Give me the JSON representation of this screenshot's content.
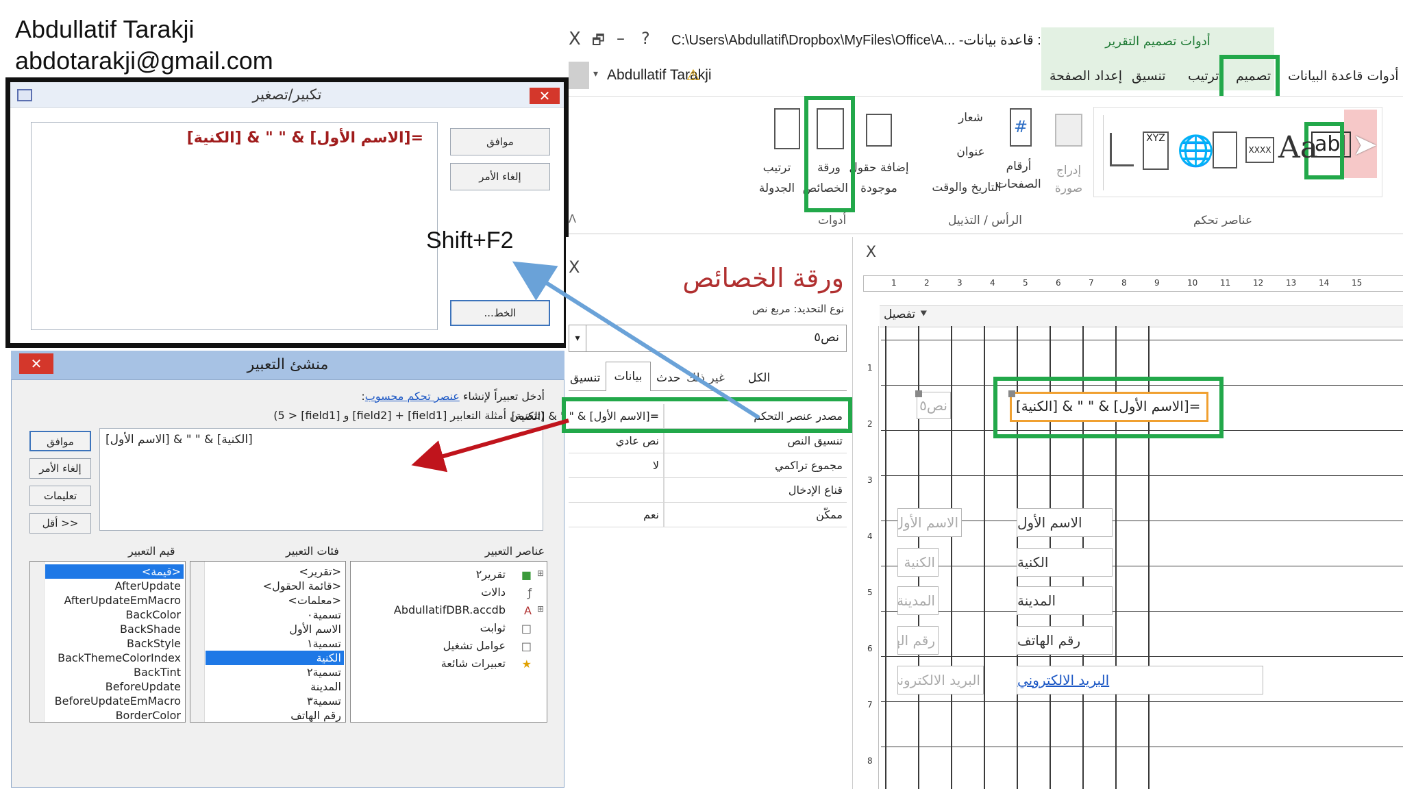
{
  "author": {
    "name": "Abdullatif Tarakji",
    "email": "abdotarakji@gmail.com"
  },
  "shortcut_annotation": "Shift+F2",
  "zoom_dialog": {
    "title": "تكبير/تصغير",
    "expression": "=[الاسم الأول] & \" \" & [الكنية]",
    "ok_label": "موافق",
    "cancel_label": "إلغاء الأمر",
    "font_label": "الخط..."
  },
  "expression_builder": {
    "title": "منشئ التعبير",
    "instruction_prefix": "أدخل تعبيراً لإنشاء ",
    "instruction_link": "عنصر تحكم محسوب",
    "instruction_suffix": ":",
    "examples_text": "(تتضمن أمثلة التعابير [field1] + [field2] و [field1] < 5)",
    "expression": "[الكنية] & \" \" & [الاسم الأول]",
    "buttons": {
      "ok": "موافق",
      "cancel": "إلغاء الأمر",
      "help": "تعليمات",
      "less": "<< أقل"
    },
    "elements_header": "عناصر التعبير",
    "categories_header": "فئات التعبير",
    "values_header": "قيم التعبير",
    "elements": [
      "تقرير٢",
      "دالات",
      "AbdullatifDBR.accdb",
      "ثوابت",
      "عوامل تشغيل",
      "تعبيرات شائعة"
    ],
    "categories": [
      "<تقرير>",
      "<قائمة الحقول>",
      "<معلمات>",
      "تسمية٠",
      "الاسم الأول",
      "تسمية١",
      "الكنية",
      "تسمية٢",
      "المدينة",
      "تسمية٣",
      "رقم الهاتف"
    ],
    "values": [
      "<قيمة>",
      "AfterUpdate",
      "AfterUpdateEmMacro",
      "BackColor",
      "BackShade",
      "BackStyle",
      "BackThemeColorIndex",
      "BackTint",
      "BeforeUpdate",
      "BeforeUpdateEmMacro",
      "BorderColor"
    ]
  },
  "access": {
    "titlebar": {
      "path": "C:\\Users\\Abdullatif\\Dropbox\\MyFiles\\Office\\A... -قاعدة بيانات : AbdullatifDBR",
      "close": "X",
      "restore": "🗗",
      "minimize": "–",
      "help": "?",
      "context_tab": "أدوات تصميم التقرير"
    },
    "user": "Abdullatif Tarakji",
    "ribbon_tabs": [
      "أدوات قاعدة البيانات",
      "تصميم",
      "ترتيب",
      "تنسيق",
      "إعداد الصفحة"
    ],
    "ribbon": {
      "controls_group": "عناصر تحكم",
      "header_footer_group": "الرأس / التذييل",
      "tools_group": "أدوات",
      "insert_image": "إدراج صورة",
      "page_numbers": "أرقام الصفحات",
      "logo": "شعار",
      "title": "عنوان",
      "date_time": "التاريخ والوقت",
      "add_fields": "إضافة حقول موجودة",
      "property_sheet": "ورقة الخصائص",
      "tab_order": "ترتيب الجدولة",
      "xyz": "XYZ",
      "xxxx": "XXXX",
      "aa": "Aa",
      "abl": "ab|"
    },
    "property_sheet": {
      "close": "X",
      "title": "ورقة الخصائص",
      "selection_type": "نوع التحديد:  مربع نص",
      "selected_object": "نص٥",
      "tabs": [
        "الكل",
        "غير ذلك",
        "حدث",
        "بيانات",
        "تنسيق"
      ],
      "rows": [
        {
          "name": "مصدر عنصر التحكم",
          "value": "=[الاسم الأول] & \" \" & [الكنية]"
        },
        {
          "name": "تنسيق النص",
          "value": "نص عادي"
        },
        {
          "name": "مجموع تراكمي",
          "value": "لا"
        },
        {
          "name": "قناع الإدخال",
          "value": ""
        },
        {
          "name": "ممكّن",
          "value": "نعم"
        }
      ]
    },
    "design": {
      "close": "X",
      "section": "تفصيل",
      "ruler": [
        "1",
        "2",
        "3",
        "4",
        "5",
        "6",
        "7",
        "8",
        "9",
        "10",
        "11",
        "12",
        "13",
        "14",
        "15"
      ],
      "vruler": [
        "1",
        "2",
        "3",
        "4",
        "5",
        "6",
        "7",
        "8"
      ],
      "new_label": "نص٥",
      "new_textbox": "=[الاسم الأول] & \" \" & [الكنية]",
      "field_labels": [
        "الاسم الأول",
        "الكنية",
        "المدينة",
        "رقم الهاتف",
        "البريد الالكتروني"
      ],
      "field_boxes": [
        "الاسم الأول",
        "الكنية",
        "المدينة",
        "رقم الهاتف",
        "البريد الالكتروني"
      ]
    }
  }
}
